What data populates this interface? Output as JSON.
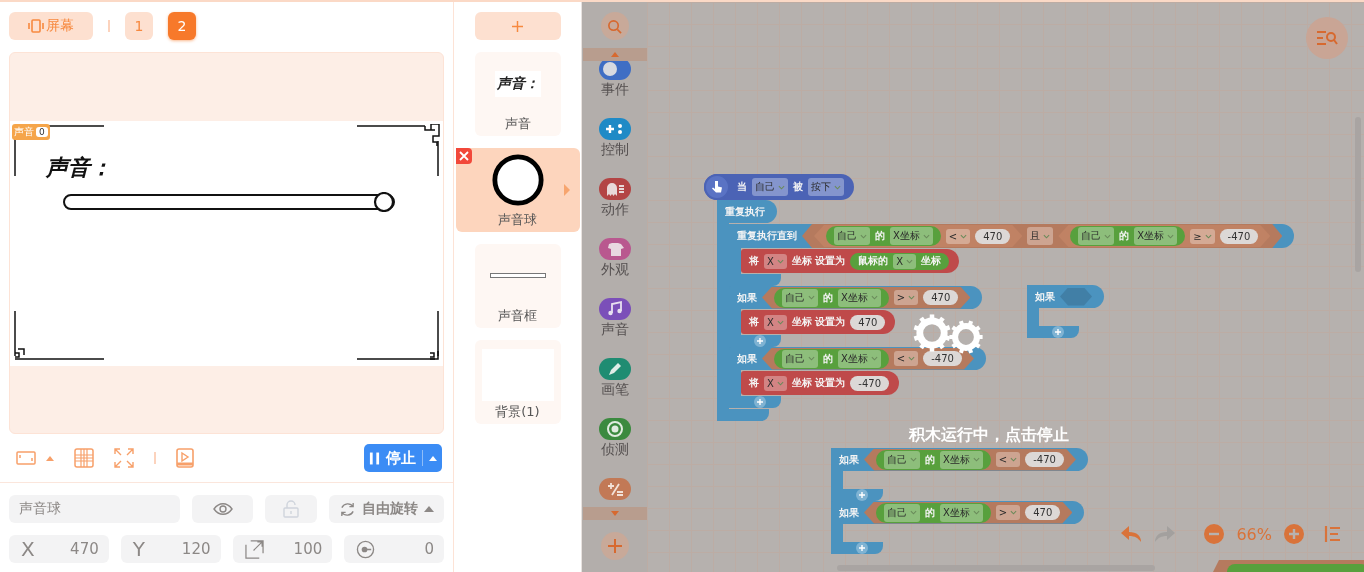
{
  "stage_bar": {
    "screen_button": "屏幕",
    "pages": [
      {
        "label": "1",
        "selected": false
      },
      {
        "label": "2",
        "selected": true
      }
    ]
  },
  "stage": {
    "variable": {
      "name": "声音",
      "value": "0"
    },
    "text": "声音："
  },
  "stage_tools": {
    "stop_button": "停止"
  },
  "properties": {
    "disabled": true,
    "name": "声音球",
    "rotation": "自由旋转",
    "fields": [
      {
        "kind": "x",
        "label": "X",
        "value": "470"
      },
      {
        "kind": "y",
        "label": "Y",
        "value": "120"
      },
      {
        "kind": "size",
        "value": "100"
      },
      {
        "kind": "direction",
        "value": "0"
      }
    ]
  },
  "sprites": [
    {
      "name": "声音",
      "kind": "text",
      "thumb_text": "声音：",
      "selected": false
    },
    {
      "name": "声音球",
      "kind": "ball",
      "selected": true
    },
    {
      "name": "声音框",
      "kind": "bar",
      "selected": false
    },
    {
      "name": "背景(1)",
      "kind": "backdrop",
      "selected": false
    }
  ],
  "categories": [
    {
      "kind": "event",
      "label": "事件",
      "color": "#3f6ec4"
    },
    {
      "kind": "control",
      "label": "控制",
      "color": "#1f8ac6"
    },
    {
      "kind": "motion",
      "label": "动作",
      "color": "#b34444"
    },
    {
      "kind": "looks",
      "label": "外观",
      "color": "#b9588f"
    },
    {
      "kind": "sound",
      "label": "声音",
      "color": "#7b4fb9"
    },
    {
      "kind": "pen",
      "label": "画笔",
      "color": "#1f8c72"
    },
    {
      "kind": "sensing",
      "label": "侦测",
      "color": "#3b8a3f"
    },
    {
      "kind": "operator",
      "color": "#c27956"
    }
  ],
  "scripts": [
    {
      "blocks": [
        {
          "kind": "event",
          "parts": [
            {
              "kind": "text",
              "text": "当"
            },
            {
              "kind": "dropdown",
              "text": "自己"
            },
            {
              "kind": "text",
              "text": "被"
            },
            {
              "kind": "dropdown",
              "text": "按下"
            }
          ]
        },
        {
          "kind": "control",
          "parts": [
            {
              "kind": "text",
              "text": "重复执行"
            }
          ],
          "children": [
            {
              "kind": "control",
              "parts": [
                {
                  "kind": "text",
                  "text": "重复执行直到"
                },
                {
                  "kind": "boolean",
                  "parts": [
                    {
                      "kind": "boolean",
                      "parts": [
                        {
                          "kind": "reporter",
                          "parts": [
                            {
                              "kind": "dropdown",
                              "text": "自己"
                            },
                            {
                              "kind": "text",
                              "text": "的"
                            },
                            {
                              "kind": "dropdown",
                              "text": "X坐标"
                            }
                          ]
                        },
                        {
                          "kind": "dropdown",
                          "text": "<"
                        },
                        {
                          "kind": "number",
                          "text": "470"
                        }
                      ]
                    },
                    {
                      "kind": "dropdown",
                      "text": "且"
                    },
                    {
                      "kind": "boolean",
                      "parts": [
                        {
                          "kind": "reporter",
                          "parts": [
                            {
                              "kind": "dropdown",
                              "text": "自己"
                            },
                            {
                              "kind": "text",
                              "text": "的"
                            },
                            {
                              "kind": "dropdown",
                              "text": "X坐标"
                            }
                          ]
                        },
                        {
                          "kind": "dropdown",
                          "text": "≥"
                        },
                        {
                          "kind": "number",
                          "text": "-470"
                        }
                      ]
                    }
                  ]
                }
              ],
              "children": [
                {
                  "kind": "motion",
                  "parts": [
                    {
                      "kind": "text",
                      "text": "将"
                    },
                    {
                      "kind": "dropdown",
                      "text": "X"
                    },
                    {
                      "kind": "text",
                      "text": "坐标 设置为"
                    },
                    {
                      "kind": "reporter",
                      "parts": [
                        {
                          "kind": "text",
                          "text": "鼠标的"
                        },
                        {
                          "kind": "dropdown",
                          "text": "X"
                        },
                        {
                          "kind": "text",
                          "text": "坐标"
                        }
                      ]
                    }
                  ]
                }
              ]
            },
            {
              "kind": "control",
              "add_button": true,
              "parts": [
                {
                  "kind": "text",
                  "text": "如果"
                },
                {
                  "kind": "boolean",
                  "parts": [
                    {
                      "kind": "reporter",
                      "parts": [
                        {
                          "kind": "dropdown",
                          "text": "自己"
                        },
                        {
                          "kind": "text",
                          "text": "的"
                        },
                        {
                          "kind": "dropdown",
                          "text": "X坐标"
                        }
                      ]
                    },
                    {
                      "kind": "dropdown",
                      "text": ">"
                    },
                    {
                      "kind": "number",
                      "text": "470"
                    }
                  ]
                }
              ],
              "children": [
                {
                  "kind": "motion",
                  "parts": [
                    {
                      "kind": "text",
                      "text": "将"
                    },
                    {
                      "kind": "dropdown",
                      "text": "X"
                    },
                    {
                      "kind": "text",
                      "text": "坐标 设置为"
                    },
                    {
                      "kind": "number",
                      "text": "470"
                    }
                  ]
                }
              ]
            },
            {
              "kind": "control",
              "add_button": true,
              "parts": [
                {
                  "kind": "text",
                  "text": "如果"
                },
                {
                  "kind": "boolean",
                  "parts": [
                    {
                      "kind": "reporter",
                      "parts": [
                        {
                          "kind": "dropdown",
                          "text": "自己"
                        },
                        {
                          "kind": "text",
                          "text": "的"
                        },
                        {
                          "kind": "dropdown",
                          "text": "X坐标"
                        }
                      ]
                    },
                    {
                      "kind": "dropdown",
                      "text": "<"
                    },
                    {
                      "kind": "number",
                      "text": "-470"
                    }
                  ]
                }
              ],
              "children": [
                {
                  "kind": "motion",
                  "parts": [
                    {
                      "kind": "text",
                      "text": "将"
                    },
                    {
                      "kind": "dropdown",
                      "text": "X"
                    },
                    {
                      "kind": "text",
                      "text": "坐标 设置为"
                    },
                    {
                      "kind": "number",
                      "text": "-470"
                    }
                  ]
                }
              ]
            }
          ]
        }
      ]
    },
    {
      "blocks": [
        {
          "kind": "control",
          "add_button": true,
          "parts": [
            {
              "kind": "text",
              "text": "如果"
            },
            {
              "kind": "slot"
            }
          ]
        }
      ]
    },
    {
      "blocks": [
        {
          "kind": "control",
          "add_button": true,
          "parts": [
            {
              "kind": "text",
              "text": "如果"
            },
            {
              "kind": "boolean",
              "parts": [
                {
                  "kind": "reporter",
                  "parts": [
                    {
                      "kind": "dropdown",
                      "text": "自己"
                    },
                    {
                      "kind": "text",
                      "text": "的"
                    },
                    {
                      "kind": "dropdown",
                      "text": "X坐标"
                    }
                  ]
                },
                {
                  "kind": "dropdown",
                  "text": "<"
                },
                {
                  "kind": "number",
                  "text": "-470"
                }
              ]
            }
          ]
        },
        {
          "kind": "control",
          "add_button": true,
          "parts": [
            {
              "kind": "text",
              "text": "如果"
            },
            {
              "kind": "boolean",
              "parts": [
                {
                  "kind": "reporter",
                  "parts": [
                    {
                      "kind": "dropdown",
                      "text": "自己"
                    },
                    {
                      "kind": "text",
                      "text": "的"
                    },
                    {
                      "kind": "dropdown",
                      "text": "X坐标"
                    }
                  ]
                },
                {
                  "kind": "dropdown",
                  "text": ">"
                },
                {
                  "kind": "number",
                  "text": "470"
                }
              ]
            }
          ]
        }
      ]
    }
  ],
  "overlay": {
    "message": "积木运行中，点击停止"
  },
  "canvas_controls": {
    "undo": {
      "disabled": false
    },
    "redo": {
      "disabled": true
    },
    "zoom": "66%"
  }
}
